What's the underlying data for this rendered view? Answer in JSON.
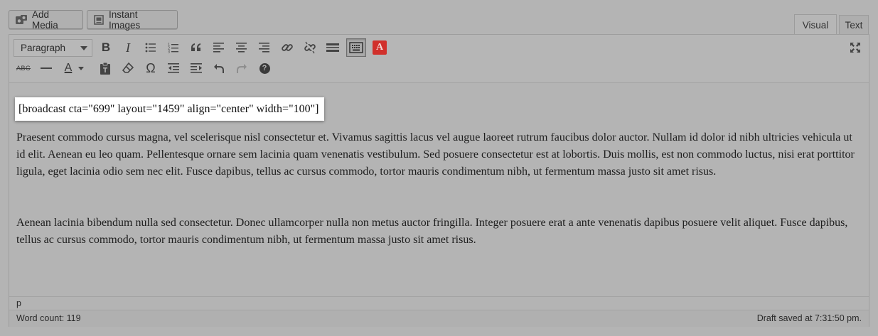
{
  "media_buttons": {
    "add_media": {
      "label": "Add Media",
      "icon": "media-camera-icon"
    },
    "instant_images": {
      "label": "Instant Images",
      "icon": "images-icon"
    }
  },
  "tabs": [
    {
      "label": "Visual",
      "active": true
    },
    {
      "label": "Text",
      "active": false
    }
  ],
  "toolbar": {
    "format_select": {
      "value": "Paragraph"
    },
    "row1_icons": [
      "bold-icon",
      "italic-icon",
      "bulleted-list-icon",
      "numbered-list-icon",
      "blockquote-icon",
      "align-left-icon",
      "align-center-icon",
      "align-right-icon",
      "insert-link-icon",
      "remove-link-icon",
      "read-more-icon",
      "toolbar-toggle-icon",
      "plugin-a-icon"
    ],
    "row2_icons": [
      "strikethrough-icon",
      "horizontal-line-icon",
      "text-color-icon",
      "paste-text-icon",
      "clear-formatting-icon",
      "special-character-icon",
      "outdent-icon",
      "indent-icon",
      "undo-icon",
      "redo-icon",
      "help-icon"
    ],
    "bold_glyph": "B",
    "italic_glyph": "I",
    "strike_glyph": "ABC",
    "text_color_glyph": "A",
    "omega_glyph": "Ω",
    "plugin_glyph": "A",
    "help_glyph": "?",
    "plugin_color": "#d1302b"
  },
  "content": {
    "shortcode": "[broadcast cta=\"699\" layout=\"1459\" align=\"center\" width=\"100\"]",
    "paragraphs": [
      "Praesent commodo cursus magna, vel scelerisque nisl consectetur et. Vivamus sagittis lacus vel augue laoreet rutrum faucibus dolor auctor. Nullam id dolor id nibh ultricies vehicula ut id elit. Aenean eu leo quam. Pellentesque ornare sem lacinia quam venenatis vestibulum. Sed posuere consectetur est at lobortis. Duis mollis, est non commodo luctus, nisi erat porttitor ligula, eget lacinia odio sem nec elit. Fusce dapibus, tellus ac cursus commodo, tortor mauris condimentum nibh, ut fermentum massa justo sit amet risus.",
      "Aenean lacinia bibendum nulla sed consectetur. Donec ullamcorper nulla non metus auctor fringilla. Integer posuere erat a ante venenatis dapibus posuere velit aliquet. Fusce dapibus, tellus ac cursus commodo, tortor mauris condimentum nibh, ut fermentum massa justo sit amet risus."
    ]
  },
  "status": {
    "path": "p",
    "word_count": "Word count: 119",
    "draft_saved": "Draft saved at 7:31:50 pm."
  }
}
